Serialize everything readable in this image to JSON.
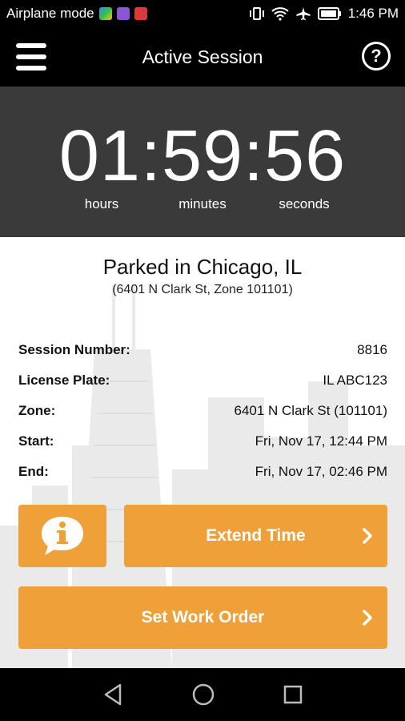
{
  "status_bar": {
    "left_text": "Airplane mode",
    "time": "1:46 PM"
  },
  "app_bar": {
    "title": "Active Session"
  },
  "timer": {
    "value": "01:59:56",
    "units": [
      "hours",
      "minutes",
      "seconds"
    ]
  },
  "location": {
    "title": "Parked in Chicago, IL",
    "subtitle": "(6401 N Clark St, Zone 101101)"
  },
  "details": [
    {
      "label": "Session Number:",
      "value": "8816"
    },
    {
      "label": "License Plate:",
      "value": "IL ABC123"
    },
    {
      "label": "Zone:",
      "value": "6401 N Clark St (101101)"
    },
    {
      "label": "Start:",
      "value": "Fri, Nov 17, 12:44 PM"
    },
    {
      "label": "End:",
      "value": "Fri, Nov 17, 02:46 PM"
    }
  ],
  "actions": {
    "extend_label": "Extend Time",
    "work_order_label": "Set Work Order"
  },
  "colors": {
    "accent": "#f0a038",
    "timer_bg": "#3a3a3a"
  },
  "icons": [
    "menu-icon",
    "help-icon",
    "info-icon",
    "chevron-right-icon",
    "back-icon",
    "home-icon",
    "recents-icon"
  ]
}
